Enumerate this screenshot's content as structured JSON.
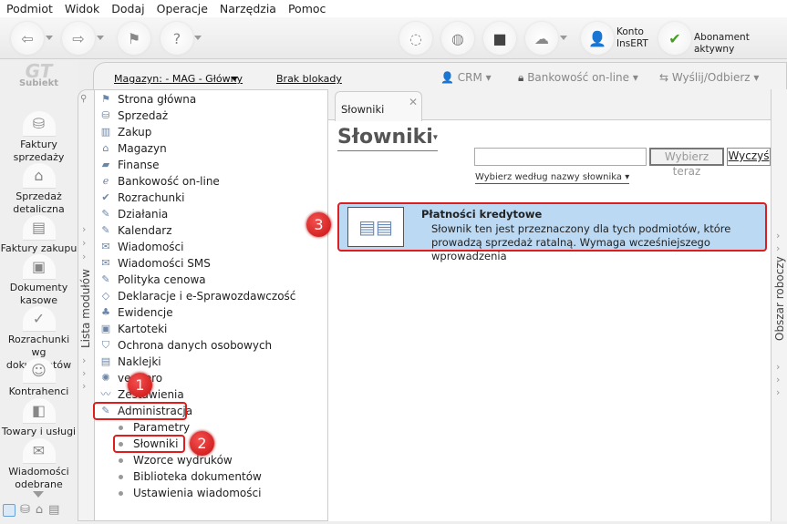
{
  "menu": [
    "Podmiot",
    "Widok",
    "Dodaj",
    "Operacje",
    "Narzędzia",
    "Pomoc"
  ],
  "toolbar": {
    "konto_line1": "Konto",
    "konto_line2": "InsERT",
    "abonament": "Abonament aktywny",
    "insert_logo": "InsERT"
  },
  "app_logo": "Subiekt",
  "left_nav": [
    "Faktury sprzedaży",
    "Sprzedaż detaliczna",
    "Faktury zakupu",
    "Dokumenty kasowe",
    "Rozrachunki wg dokumentów",
    "Kontrahenci",
    "Towary i usługi",
    "Wiadomości odebrane"
  ],
  "header": {
    "magazyn": "Magazyn: - MAG - Główny",
    "blokada": "Brak blokady",
    "crm": "CRM",
    "bank": "Bankowość on-line",
    "send": "Wyślij/Odbierz"
  },
  "modules": {
    "strip_label": "Lista modułów",
    "items": [
      "Strona główna",
      "Sprzedaż",
      "Zakup",
      "Magazyn",
      "Finanse",
      "Bankowość on-line",
      "Rozrachunki",
      "Działania",
      "Kalendarz",
      "Wiadomości",
      "Wiadomości SMS",
      "Polityka cenowa",
      "Deklaracje i e-Sprawozdawczość",
      "Ewidencje",
      "Kartoteki",
      "Ochrona danych osobowych",
      "Naklejki",
      "vendero",
      "Zestawienia",
      "Administracja"
    ],
    "sub_items": [
      "Parametry",
      "Słowniki",
      "Wzorce wydruków",
      "Biblioteka dokumentów",
      "Ustawienia wiadomości"
    ]
  },
  "content": {
    "tab": "Słowniki",
    "title": "Słowniki",
    "search_value": "",
    "btn_select": "Wybierz teraz",
    "btn_clear": "Wyczyś",
    "by_name": "Wybierz według nazwy słownika",
    "card": {
      "title": "Płatności kredytowe",
      "desc": "Słownik ten jest przeznaczony dla tych podmiotów, które prowadzą sprzedaż ratalną. Wymaga wcześniejszego wprowadzenia"
    }
  },
  "right_strip": "Obszar roboczy",
  "badges": [
    "1",
    "2",
    "3"
  ],
  "colors": {
    "highlight": "#e01c1c",
    "card_bg": "#bbd9f2"
  }
}
